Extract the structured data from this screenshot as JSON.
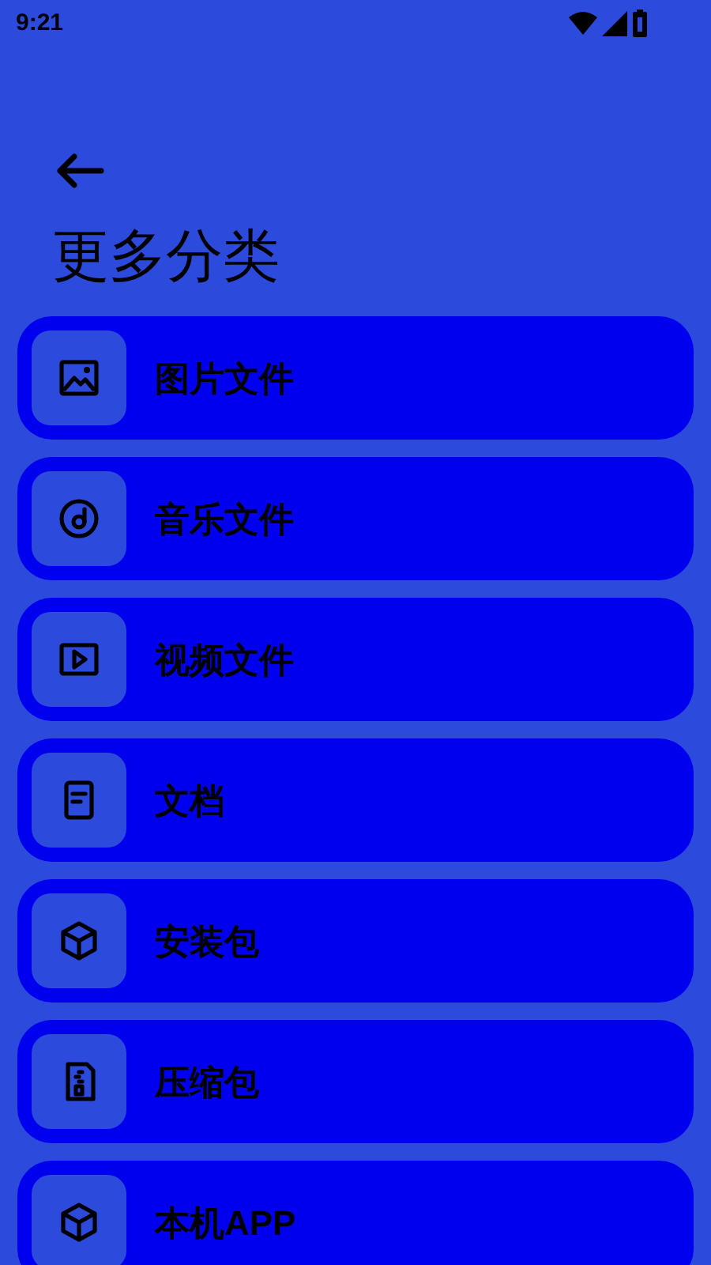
{
  "status_bar": {
    "time": "9:21"
  },
  "title": "更多分类",
  "categories": [
    {
      "label": "图片文件",
      "kind": "image"
    },
    {
      "label": "音乐文件",
      "kind": "music"
    },
    {
      "label": "视频文件",
      "kind": "video"
    },
    {
      "label": "文档",
      "kind": "document"
    },
    {
      "label": "安装包",
      "kind": "package"
    },
    {
      "label": "压缩包",
      "kind": "archive"
    },
    {
      "label": "本机APP",
      "kind": "package"
    }
  ]
}
